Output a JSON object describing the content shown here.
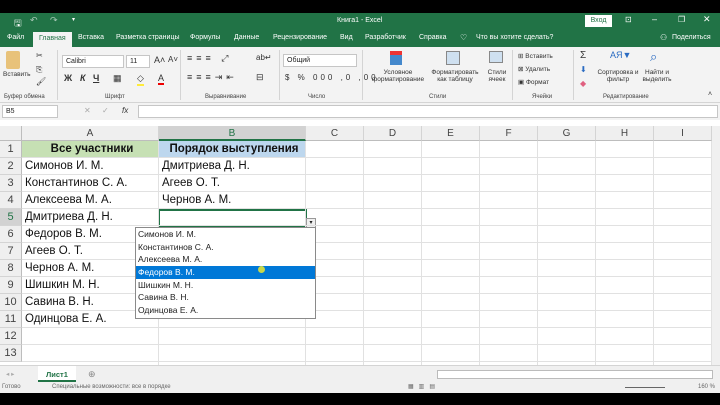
{
  "window": {
    "title": "Книга1  -  Excel",
    "login": "Вход"
  },
  "tabs": [
    "Файл",
    "Главная",
    "Вставка",
    "Разметка страницы",
    "Формулы",
    "Данные",
    "Рецензирование",
    "Вид",
    "Разработчик",
    "Справка"
  ],
  "tell_me": "Что вы хотите сделать?",
  "share": "Поделиться",
  "ribbon": {
    "paste": "Вставить",
    "clipboard": "Буфер обмена",
    "font_name": "Calibri",
    "font_size": "11",
    "bold": "Ж",
    "italic": "К",
    "underline": "Ч",
    "font": "Шрифт",
    "alignment": "Выравнивание",
    "number_format": "Общий",
    "number": "Число",
    "cond_format": "Условное форматирование",
    "format_table": "Форматировать как таблицу",
    "cell_styles": "Стили ячеек",
    "styles": "Стили",
    "insert": "Вставить",
    "delete": "Удалить",
    "format": "Формат",
    "cells": "Ячейки",
    "sort": "Сортировка и фильтр",
    "find": "Найти и выделить",
    "editing": "Редактирование"
  },
  "formula_bar": {
    "name_box": "B5",
    "fx": "fx",
    "value": ""
  },
  "columns": [
    "A",
    "B",
    "C",
    "D",
    "E",
    "F",
    "G",
    "H",
    "I"
  ],
  "rows": [
    "1",
    "2",
    "3",
    "4",
    "5",
    "6",
    "7",
    "8",
    "9",
    "10",
    "11",
    "12",
    "13"
  ],
  "col_a": [
    "Все участники",
    "Симонов И. М.",
    "Константинов С. А.",
    "Алексеева М. А.",
    "Дмитриева Д. Н.",
    "Федоров В. М.",
    "Агеев О. Т.",
    "Чернов А. М.",
    "Шишкин М. Н.",
    "Савина В. Н.",
    "Одинцова Е. А."
  ],
  "col_b": [
    "Порядок выступления",
    "Дмитриева Д. Н.",
    "Агеев О. Т.",
    "Чернов А. М."
  ],
  "dropdown": {
    "items": [
      "Симонов И. М.",
      "Константинов С. А.",
      "Алексеева М. А.",
      "Федоров В. М.",
      "Шишкин М. Н.",
      "Савина В. Н.",
      "Одинцова Е. А."
    ],
    "highlighted": 3
  },
  "sheet_tab": "Лист1",
  "status": {
    "ready": "Готово",
    "accessibility": "Специальные возможности: все в порядке",
    "zoom": "160 %"
  },
  "colors": {
    "excel_green": "#217346",
    "header_a": "#c6e0b4",
    "header_b": "#bdd7ee",
    "highlight": "#0078d7"
  }
}
